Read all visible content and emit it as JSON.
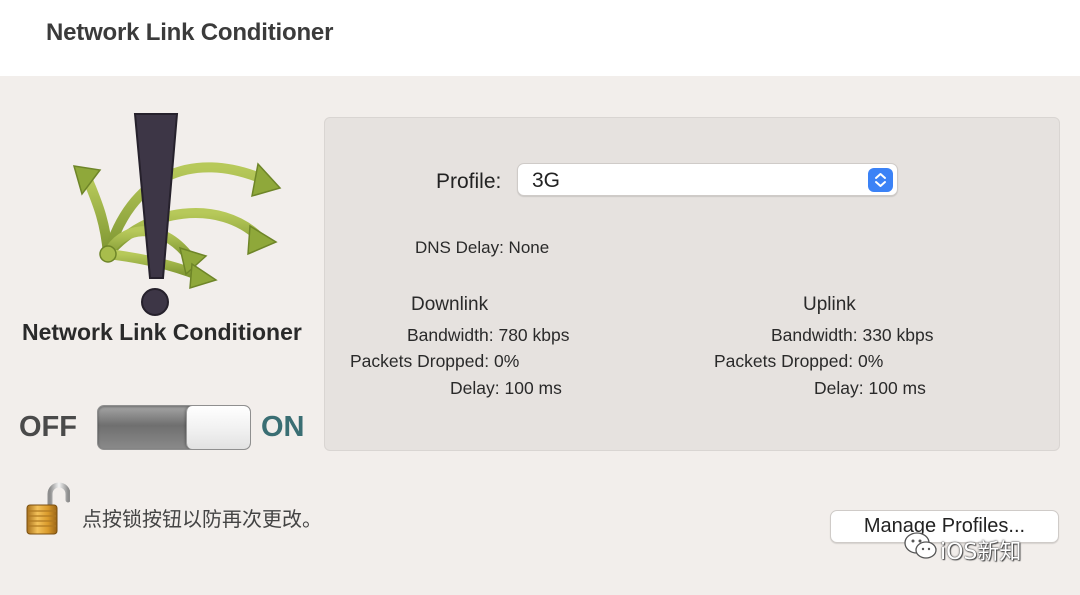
{
  "window": {
    "title": "Network Link Conditioner"
  },
  "sidebar": {
    "logo_icon": "network-link-conditioner-icon",
    "caption": "Network Link Conditioner",
    "switch": {
      "off_label": "OFF",
      "on_label": "ON",
      "state": "on"
    }
  },
  "profile": {
    "label": "Profile:",
    "selected": "3G"
  },
  "dns": {
    "label": "DNS Delay:",
    "value": "None"
  },
  "downlink": {
    "title": "Downlink",
    "bandwidth_label": "Bandwidth:",
    "bandwidth": "780 kbps",
    "packets_label": "Packets Dropped:",
    "packets": "0%",
    "delay_label": "Delay:",
    "delay": "100 ms"
  },
  "uplink": {
    "title": "Uplink",
    "bandwidth_label": "Bandwidth:",
    "bandwidth": "330 kbps",
    "packets_label": "Packets Dropped:",
    "packets": "0%",
    "delay_label": "Delay:",
    "delay": "100 ms"
  },
  "lock": {
    "icon": "unlocked-padlock-icon",
    "text": "点按锁按钮以防再次更改。"
  },
  "manage_button": {
    "label": "Manage Profiles..."
  },
  "watermark": {
    "icon": "wechat-icon",
    "text": "iOS新知"
  },
  "colors": {
    "background": "#f2eeeb",
    "panel": "#e6e2df",
    "accent_blue": "#3b82f6",
    "on_label": "#3a6e73",
    "arrow_green": "#9cb33e"
  }
}
